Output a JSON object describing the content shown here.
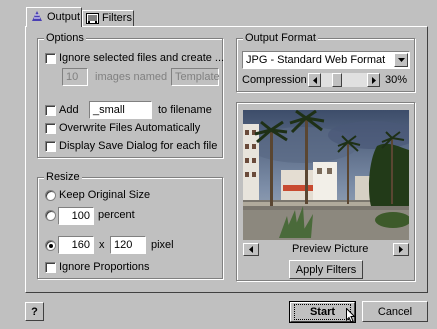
{
  "tabs": [
    {
      "label": "Output",
      "icon": "output-icon",
      "active": true
    },
    {
      "label": "Filters",
      "icon": "filters-icon",
      "active": false
    }
  ],
  "options": {
    "title": "Options",
    "ignore_selected": {
      "label": "Ignore selected files and create ...",
      "checked": false
    },
    "images_count": "10",
    "images_named_label": "images named",
    "template_placeholder": "Template",
    "add": {
      "label": "Add",
      "checked": false,
      "value": "_small",
      "suffix_label": "to filename"
    },
    "overwrite": {
      "label": "Overwrite Files Automatically",
      "checked": false
    },
    "display_save": {
      "label": "Display Save Dialog for each file",
      "checked": false
    }
  },
  "resize": {
    "title": "Resize",
    "keep_original": {
      "label": "Keep Original Size",
      "selected": false
    },
    "percent": {
      "value": "100",
      "label": "percent",
      "selected": false
    },
    "pixel": {
      "width": "160",
      "times": "x",
      "height": "120",
      "label": "pixel",
      "selected": true
    },
    "ignore_proportions": {
      "label": "Ignore Proportions",
      "checked": false
    }
  },
  "output_format": {
    "title": "Output Format",
    "selected": "JPG - Standard Web Format",
    "compression_label": "Compression",
    "compression_value": "30%",
    "compression_level": 0.3
  },
  "preview": {
    "label": "Preview Picture",
    "apply_label": "Apply Filters"
  },
  "footer": {
    "help_label": "?",
    "start_label": "Start",
    "cancel_label": "Cancel"
  }
}
